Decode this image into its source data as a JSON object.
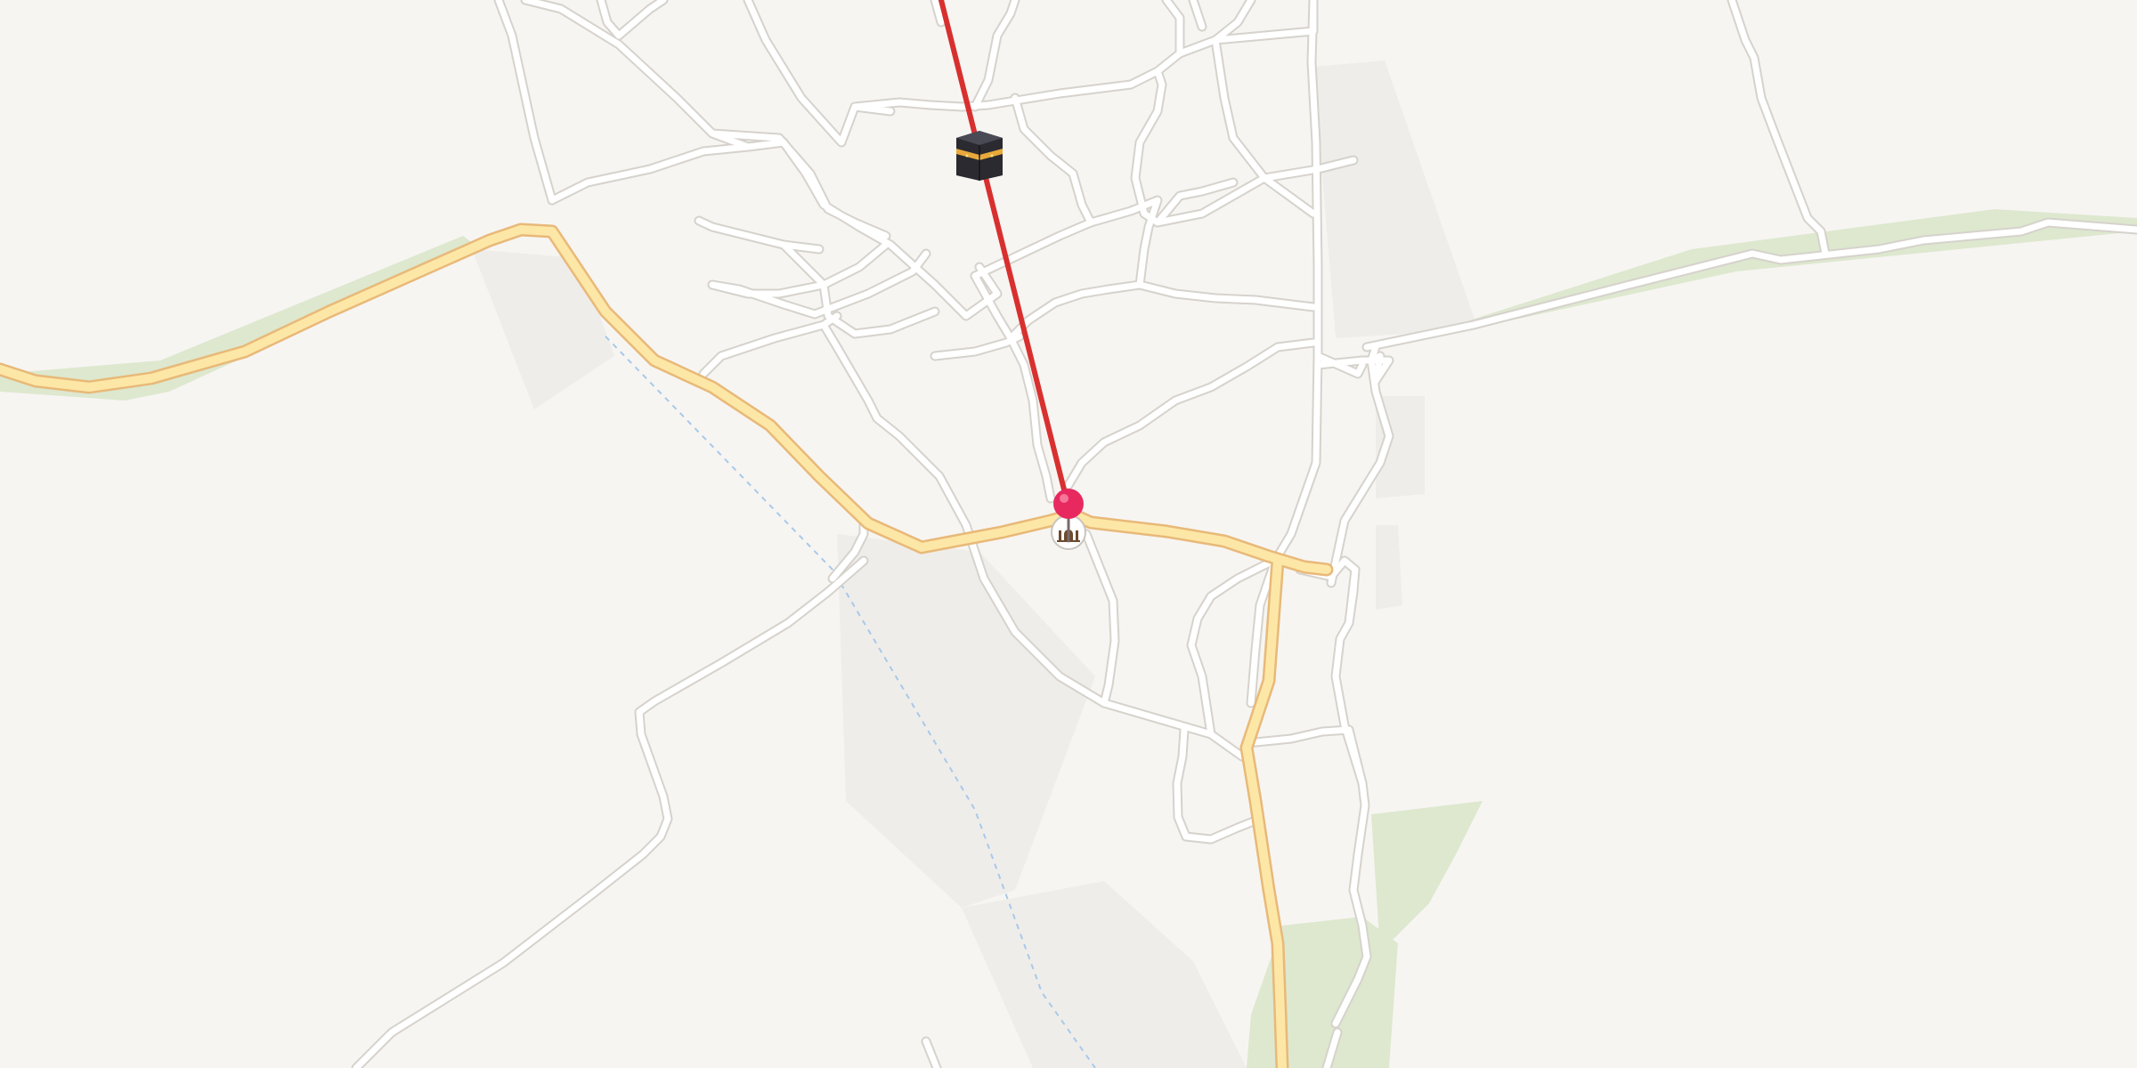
{
  "map": {
    "colors": {
      "background": "#f7f5f2",
      "minor_road": "#ffffff",
      "main_road": "#fde7a6",
      "park": "#dde8cf",
      "route_line": "#d8302f",
      "pin": "#e8295f"
    },
    "markers": [
      {
        "name": "kaaba-marker",
        "icon": "kaaba-icon",
        "label": ""
      },
      {
        "name": "mosque-marker",
        "icon": "mosque-icon",
        "label": ""
      },
      {
        "name": "location-pin",
        "icon": "map-pin-icon",
        "label": ""
      }
    ],
    "route": {
      "icon": "qibla-direction-line"
    }
  }
}
